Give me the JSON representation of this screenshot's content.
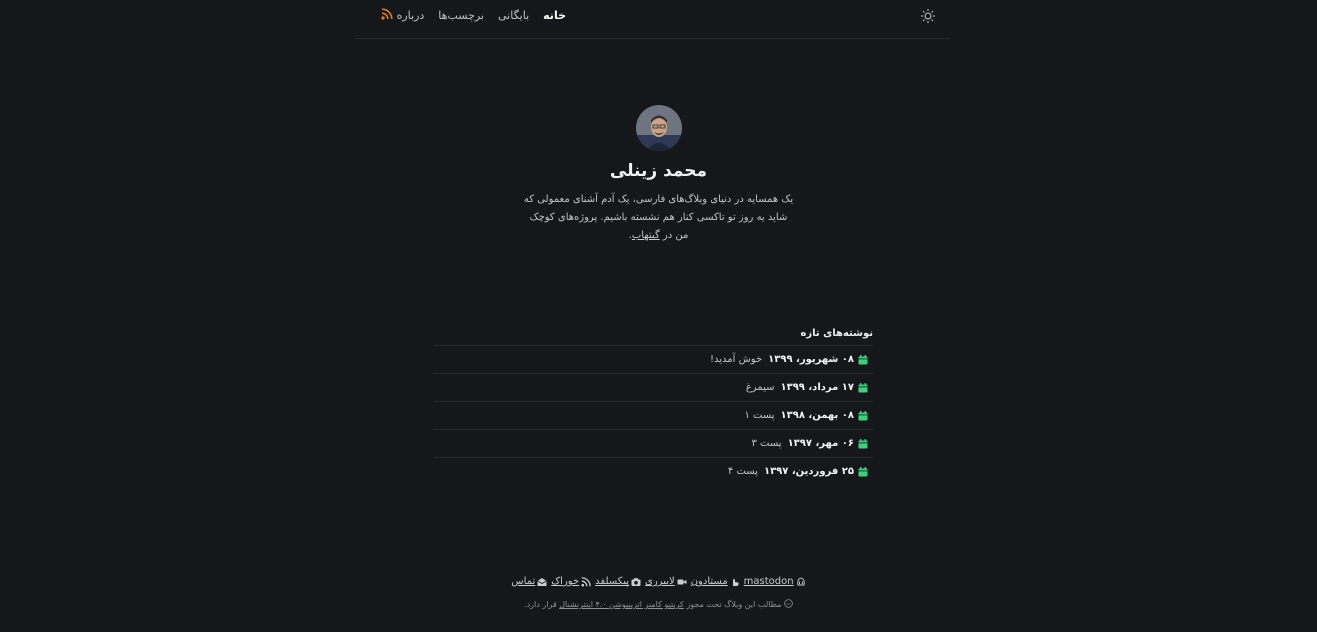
{
  "nav": {
    "items": [
      {
        "label": "خانه",
        "active": true
      },
      {
        "label": "بایگانی",
        "active": false
      },
      {
        "label": "برچسب‌ها",
        "active": false
      },
      {
        "label": "درباره",
        "active": false
      }
    ],
    "rss_icon": "rss-icon",
    "theme_icon": "sun-icon"
  },
  "profile": {
    "name": "محمد زینلی",
    "bio_text": "یک همسایه در دنیای وبلاگ‌های فارسی، یک آدم آشنای معمولی که شاید یه روز تو تاکسی کنار هم نشسته باشیم. پروژه‌های کوچک من در",
    "bio_link": "گیتهاب",
    "bio_end": "."
  },
  "recent": {
    "title": "نوشته‌های تازه",
    "posts": [
      {
        "date": "۰۸ شهریور، ۱۳۹۹",
        "title": "خوش آمدید!"
      },
      {
        "date": "۱۷ مرداد، ۱۳۹۹",
        "title": "سیمرغ"
      },
      {
        "date": "۰۸ بهمن، ۱۳۹۸",
        "title": "پست ۱"
      },
      {
        "date": "۰۶ مهر، ۱۳۹۷",
        "title": "پست ۳"
      },
      {
        "date": "۲۵ فروردین، ۱۳۹۷",
        "title": "پست ۴"
      }
    ]
  },
  "footer": {
    "links": [
      {
        "label": "mastodon",
        "icon": "mastodon-icon"
      },
      {
        "label": "مستادون",
        "icon": "hand-icon"
      },
      {
        "label": "لایبرری",
        "icon": "video-icon"
      },
      {
        "label": "پیکسلفد",
        "icon": "camera-icon"
      },
      {
        "label": "خوراک",
        "icon": "rss-icon"
      },
      {
        "label": "تماس",
        "icon": "mail-icon"
      }
    ],
    "license_prefix": "مطالب این وبلاگ تحت مجوز",
    "license_link": "کریتیو کامنز اتریبیوشن ۴.۰ اینترنشنال",
    "license_suffix": "قرار دارد.",
    "license_icon": "cc-icon"
  },
  "colors": {
    "background": "#16171b",
    "accent_green": "#3fcf7f",
    "rss_orange": "#e07a2f"
  }
}
